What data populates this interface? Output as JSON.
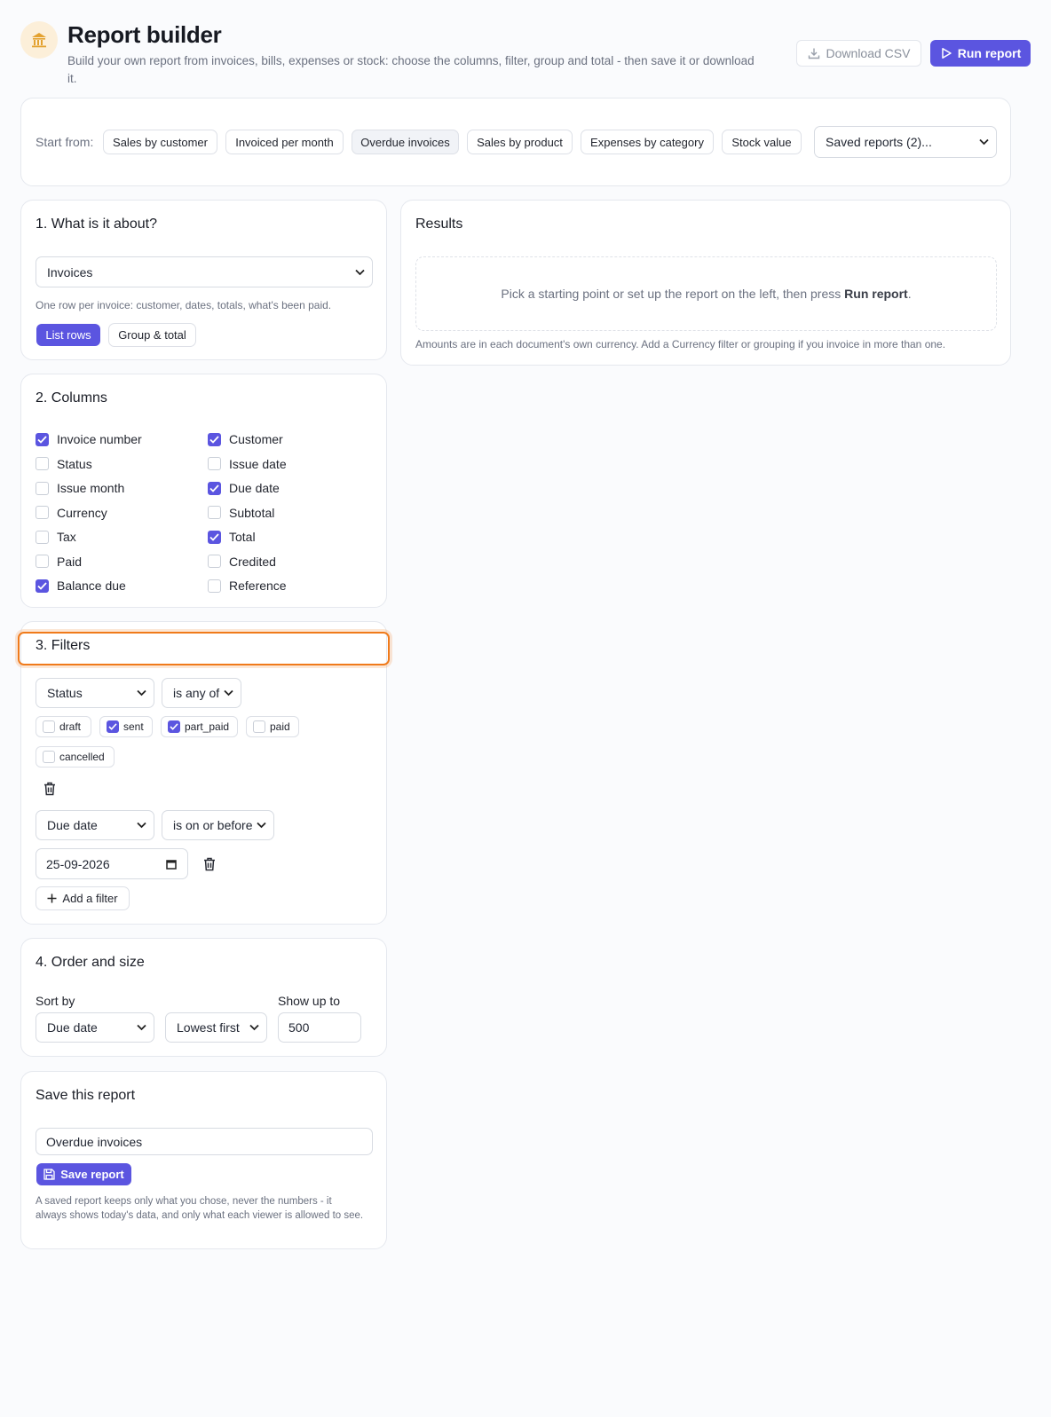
{
  "header": {
    "title": "Report builder",
    "subtitle": "Build your own report from invoices, bills, expenses or stock: choose the columns, filter, group and total - then save it or download it.",
    "download_label": "Download CSV",
    "run_label": "Run report"
  },
  "start": {
    "label": "Start from:",
    "chips": [
      "Sales by customer",
      "Invoiced per month",
      "Overdue invoices",
      "Sales by product",
      "Expenses by category",
      "Stock value"
    ],
    "saved_value": "Saved reports (2)..."
  },
  "about": {
    "title": "1. What is it about?",
    "source_value": "Invoices",
    "hint": "One row per invoice: customer, dates, totals, what's been paid.",
    "mode_list": "List rows",
    "mode_group": "Group & total"
  },
  "columns": {
    "title": "2. Columns",
    "items": [
      {
        "label": "Invoice number",
        "checked": true
      },
      {
        "label": "Customer",
        "checked": true
      },
      {
        "label": "Status",
        "checked": false
      },
      {
        "label": "Issue date",
        "checked": false
      },
      {
        "label": "Issue month",
        "checked": false
      },
      {
        "label": "Due date",
        "checked": true
      },
      {
        "label": "Currency",
        "checked": false
      },
      {
        "label": "Subtotal",
        "checked": false
      },
      {
        "label": "Tax",
        "checked": false
      },
      {
        "label": "Total",
        "checked": true
      },
      {
        "label": "Paid",
        "checked": false
      },
      {
        "label": "Credited",
        "checked": false
      },
      {
        "label": "Balance due",
        "checked": true
      },
      {
        "label": "Reference",
        "checked": false
      }
    ]
  },
  "filters": {
    "title": "3. Filters",
    "f1_field": "Status",
    "f1_op": "is any of",
    "status_options": [
      {
        "label": "draft",
        "checked": false
      },
      {
        "label": "sent",
        "checked": true
      },
      {
        "label": "part_paid",
        "checked": true
      },
      {
        "label": "paid",
        "checked": false
      },
      {
        "label": "cancelled",
        "checked": false
      }
    ],
    "f2_field": "Due date",
    "f2_op": "is on or before",
    "f2_value": "25-09-2026",
    "add_label": "Add a filter"
  },
  "order": {
    "title": "4. Order and size",
    "sort_label": "Sort by",
    "sort_field": "Due date",
    "sort_dir": "Lowest first",
    "limit_label": "Show up to",
    "limit_value": "500"
  },
  "save": {
    "title": "Save this report",
    "name_value": "Overdue invoices",
    "button_label": "Save report",
    "note": "A saved report keeps only what you chose, never the numbers - it always shows today's data, and only what each viewer is allowed to see."
  },
  "results": {
    "title": "Results",
    "empty_prefix": "Pick a starting point or set up the report on the left, then press ",
    "empty_bold": "Run report",
    "empty_suffix": ".",
    "note": "Amounts are in each document's own currency. Add a Currency filter or grouping if you invoice in more than one."
  },
  "colors": {
    "accent": "#5b55e0",
    "highlight": "#f07a1a",
    "logo_bg": "#fcefd9",
    "logo_icon": "#e3a12f"
  }
}
